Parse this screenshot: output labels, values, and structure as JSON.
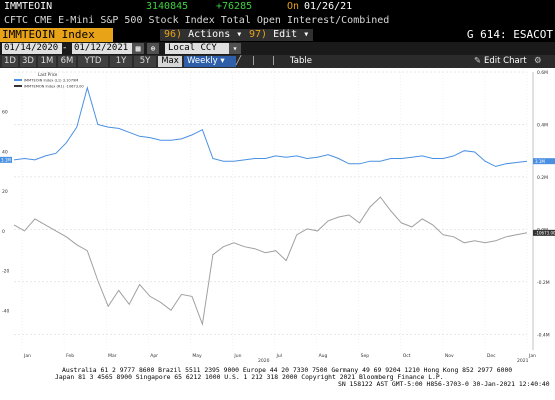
{
  "header": {
    "ticker": "IMMTEOIN",
    "last_value": "3140845",
    "change": "+76285",
    "on_label": "On",
    "date": "01/26/21",
    "description": "CFTC CME E-Mini S&P 500 Stock Index Total Open Interest/Combined"
  },
  "command_bar": {
    "security": "IMMTEOIN Index",
    "actions_label": "Actions",
    "edit_label": "Edit",
    "function_code": "G 614: ESACOT"
  },
  "date_range": {
    "start": "01/14/2020",
    "end": "01/12/2021",
    "currency": "Local CCY"
  },
  "periods": {
    "items": [
      "1D",
      "3D",
      "1M",
      "6M",
      "YTD",
      "1Y",
      "5Y",
      "Max"
    ],
    "active": "Max",
    "frequency": "Weekly",
    "table_label": "Table",
    "edit_chart_label": "Edit Chart"
  },
  "legend": {
    "title": "Last Price",
    "series": [
      "IMMTEOIN Index (L1) 3.1079M",
      "IMMTEMON Index (R1) -10673.00"
    ]
  },
  "chart_data": {
    "type": "line",
    "x": [
      "Jan",
      "",
      "Feb",
      "",
      "Mar",
      "",
      "Apr",
      "",
      "May",
      "",
      "Jun",
      "",
      "Jul",
      "",
      "Aug",
      "",
      "Sep",
      "",
      "Oct",
      "",
      "Nov",
      "",
      "Dec",
      "",
      "Jan"
    ],
    "x_ticks": [
      "Jan",
      "Feb",
      "Mar",
      "Apr",
      "May",
      "Jun",
      "Jul",
      "Aug",
      "Sep",
      "Oct",
      "Nov",
      "Dec",
      "Jan"
    ],
    "x_year_labels": [
      "2020",
      "2021"
    ],
    "left_axis": {
      "ticks": [
        "60",
        "40",
        "20",
        "0",
        "-20",
        "-40"
      ],
      "ylim": [
        -60,
        80
      ]
    },
    "right_axis": {
      "ticks": [
        "0.6M",
        "0.4M",
        "0.2M",
        "0.0M",
        "-0.2M",
        "-0.4M"
      ],
      "ylim": [
        -0.46,
        0.6
      ]
    },
    "series": [
      {
        "color": "#4a90e2",
        "axis": "right",
        "values": [
          0.265,
          0.27,
          0.265,
          0.28,
          0.29,
          0.33,
          0.39,
          0.54,
          0.4,
          0.39,
          0.385,
          0.37,
          0.355,
          0.35,
          0.34,
          0.34,
          0.345,
          0.36,
          0.38,
          0.27,
          0.26,
          0.26,
          0.265,
          0.27,
          0.27,
          0.28,
          0.275,
          0.28,
          0.27,
          0.275,
          0.285,
          0.27,
          0.25,
          0.25,
          0.26,
          0.26,
          0.27,
          0.27,
          0.275,
          0.28,
          0.27,
          0.27,
          0.28,
          0.3,
          0.295,
          0.26,
          0.24,
          0.25,
          0.255,
          0.26
        ],
        "label_value": "3.1M"
      },
      {
        "color": "#a0a0a0",
        "axis": "left",
        "values": [
          3,
          0,
          6,
          3,
          0,
          -3,
          -7,
          -10,
          -25,
          -38,
          -30,
          -37,
          -27,
          -33,
          -36,
          -40,
          -32,
          -33,
          -47,
          -12,
          -8,
          -6,
          -8,
          -9,
          -11,
          -10,
          -15,
          -2,
          1,
          0,
          5,
          7,
          8,
          4,
          12,
          17,
          10,
          4,
          2,
          6,
          3,
          -2,
          -3,
          -6,
          -5,
          -6,
          -5,
          -3,
          -2,
          -1
        ],
        "label_value": "-10673.00"
      }
    ],
    "left_edge_label": "3.1M"
  },
  "footer": {
    "line1": "Australia 61 2 9777 8600 Brazil 5511 2395 9000 Europe 44 20 7330 7500 Germany 49 69 9204 1210 Hong Kong 852 2977 6000",
    "line2": "Japan 81 3 4565 8900           Singapore 65 6212 1000       U.S. 1 212 318 2000           Copyright 2021 Bloomberg Finance L.P.",
    "line3": "SN 158122 AST  GMT-5:00 H856-3703-0 30-Jan-2021 12:40:40"
  },
  "colors": {
    "amber": "#e8a317",
    "blue_series": "#4a90e2",
    "gray_series": "#a0a0a0",
    "weekly_bg": "#2e5fa8"
  }
}
